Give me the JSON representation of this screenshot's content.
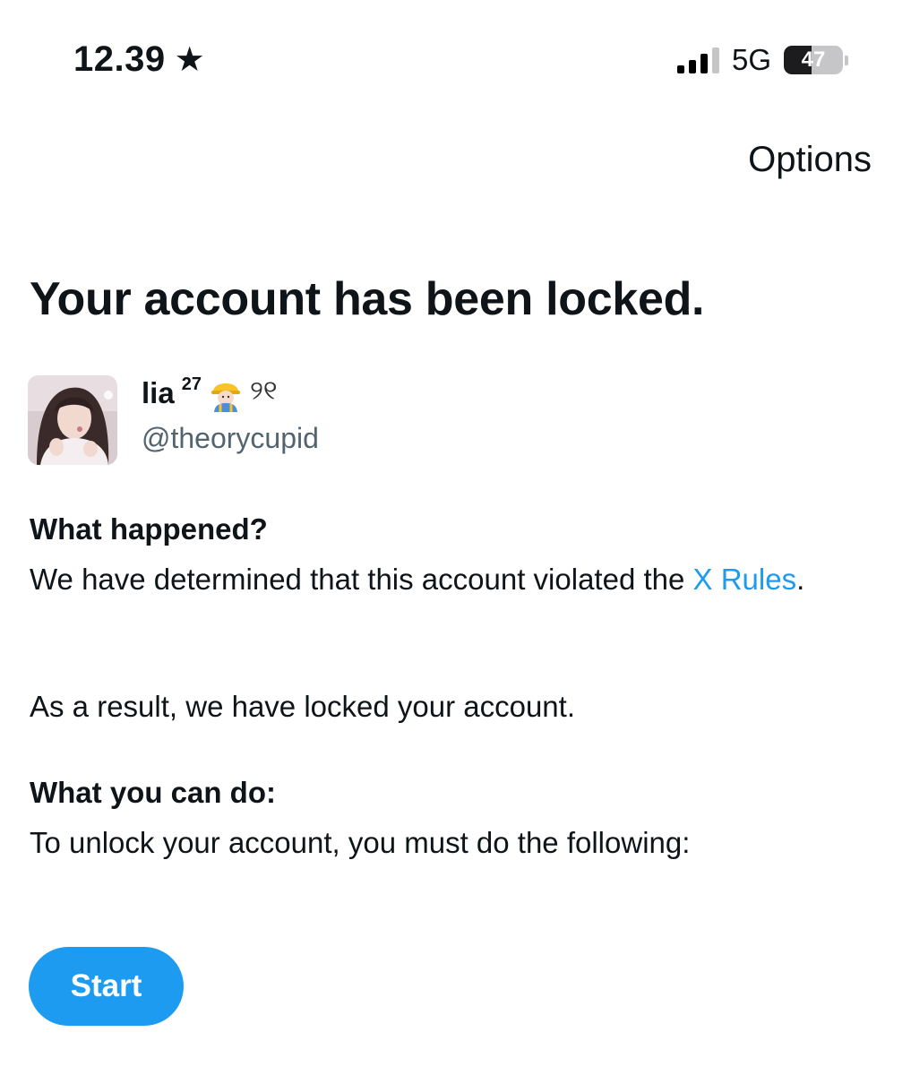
{
  "status_bar": {
    "time": "12.39",
    "network": "5G",
    "battery_percent": "47",
    "battery_level": 0.47,
    "signal_bars_filled": 3,
    "signal_bars_total": 4
  },
  "header": {
    "options_label": "Options"
  },
  "main": {
    "title": "Your account has been locked.",
    "account": {
      "display_name": "lia",
      "display_name_superscript": "27",
      "display_name_decoration": "୨୧",
      "handle": "@theorycupid"
    },
    "what_happened": {
      "heading": "What happened?",
      "text_before_link": "We have determined that this account violated the ",
      "link_text": "X Rules",
      "text_after_link": ".",
      "result_text": "As a result, we have locked your account."
    },
    "what_you_can_do": {
      "heading": "What you can do:",
      "text": "To unlock your account, you must do the following:"
    },
    "start_button_label": "Start"
  },
  "colors": {
    "accent": "#1d9bf0",
    "text_primary": "#0f1419",
    "text_secondary": "#536471"
  },
  "icons": [
    "star-icon",
    "signal-icon",
    "battery-icon",
    "avatar-image",
    "construction-worker-emoji-icon"
  ]
}
